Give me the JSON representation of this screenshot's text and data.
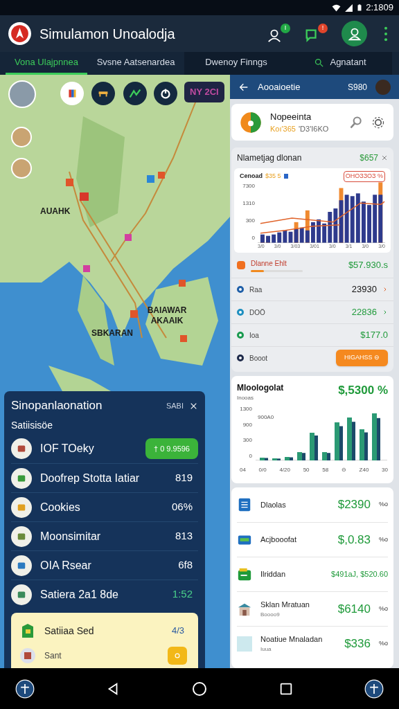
{
  "status_bar": {
    "time": "2:1809"
  },
  "app_bar": {
    "title": "Simulamon Unoalodja",
    "badges": [
      {
        "kind": "people",
        "text": "I",
        "color": "#22a845"
      },
      {
        "kind": "chat",
        "text": "!",
        "color": "#e0452b"
      }
    ]
  },
  "tabs": [
    {
      "label": "Vona Ulajpnnea",
      "selected": true,
      "kind": "text"
    },
    {
      "label": "Svsne Aatsenardea",
      "selected": false,
      "kind": "text"
    },
    {
      "label": "Dwenoy Finngs",
      "selected": false,
      "kind": "text"
    },
    {
      "label": "Agnatant",
      "selected": false,
      "kind": "search"
    }
  ],
  "map": {
    "badge": "NY 2CI",
    "labels": [
      "AUAHK",
      "BAIAWAR AKAAIK",
      "SBKARAN"
    ]
  },
  "detail_panel": {
    "title": "Aooaioetie",
    "amount": "S980",
    "profile": {
      "name": "Nopeeinta",
      "code": "Koı'365",
      "note": "'D3'I6KO"
    },
    "summary": {
      "title": "Nlametjag dlonan",
      "amount": "$657",
      "legend": [
        "Cenoad",
        "$35 5",
        "ОНОЗЗОЗ %"
      ],
      "y_ticks": [
        "7300",
        "1310",
        "300",
        "0"
      ],
      "x_ticks": [
        "3/0",
        "3/0",
        "3/03",
        "3/01",
        "3/0",
        "3/1",
        "3/0",
        "3/0"
      ],
      "rows": [
        {
          "kind": "progress",
          "label": "Dlanne Ehlt",
          "value": "$57.930.s",
          "level": 0.25
        },
        {
          "kind": "link",
          "label": "Raa",
          "value": "23930",
          "highlight": false,
          "color": "#1f5fa8"
        },
        {
          "kind": "link",
          "label": "DOÖ",
          "value": "22836",
          "highlight": true,
          "color": "#1e8fc0"
        },
        {
          "kind": "plain",
          "label": "Ioa",
          "value": "$177.0",
          "highlight": true,
          "color": "#1a9a50"
        },
        {
          "kind": "action",
          "label": "Booot",
          "button": "HIGAHSS ⊖",
          "color": "#1e2a4a"
        }
      ]
    },
    "trend": {
      "title": "Mloologolat",
      "subtitle": "Inooas",
      "amount": "$,5300 %",
      "peak_label": "900A0",
      "y_ticks": [
        "1300",
        "900",
        "300",
        "0"
      ],
      "x_ticks": [
        "04",
        "0/0",
        "4/20",
        "50",
        "58",
        "⊖",
        "Z40",
        "30"
      ]
    },
    "list": [
      {
        "kind": "document",
        "name": "Dlaolas",
        "value": "$2390",
        "unit": "%o"
      },
      {
        "kind": "card",
        "name": "Acjbooofat",
        "value": "$,0.83",
        "unit": "%o"
      },
      {
        "kind": "wallet",
        "name": "Ilriddan",
        "value": "$491aJ, $520.60"
      },
      {
        "kind": "building",
        "name": "Sklan Mratuan",
        "sub": "Boooo9",
        "value": "$6140",
        "unit": "%o"
      },
      {
        "kind": "swatch",
        "name": "Noatiue Mnaladan",
        "sub": "Iuua",
        "value": "$336",
        "unit": "%o"
      }
    ]
  },
  "stats_panel": {
    "title": "Sinopanlaonation",
    "action": "SABI",
    "subtitle": "Satiisisöe",
    "rows": [
      {
        "kind": "badge",
        "name": "IOF TOeky",
        "value": "† 0 9.9596"
      },
      {
        "kind": "plain",
        "name": "Doofrep Stotta Iatiar",
        "value": "819"
      },
      {
        "kind": "plain",
        "name": "Cookies",
        "value": "06%"
      },
      {
        "kind": "plain",
        "name": "Moonsimitar",
        "value": "813"
      },
      {
        "kind": "plain",
        "name": "OIA Rsear",
        "value": "6f8"
      },
      {
        "kind": "positive",
        "name": "Satiera 2a1 8de",
        "value": "1:52"
      }
    ],
    "highlight": {
      "name": "Satiiaa Sed",
      "value": "4/3",
      "sub": "Sant"
    }
  }
}
